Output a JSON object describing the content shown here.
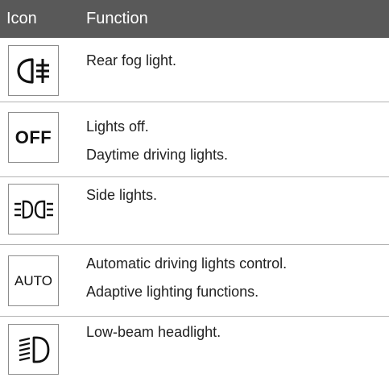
{
  "header": {
    "icon_col": "Icon",
    "function_col": "Function"
  },
  "rows": [
    {
      "icon": "rear-fog-light-icon",
      "lines": [
        "Rear fog light."
      ]
    },
    {
      "icon": "lights-off-icon",
      "icon_text": "OFF",
      "lines": [
        "Lights off.",
        "Daytime driving lights."
      ]
    },
    {
      "icon": "side-lights-icon",
      "lines": [
        "Side lights."
      ]
    },
    {
      "icon": "auto-lights-icon",
      "icon_text": "AUTO",
      "lines": [
        "Automatic driving lights control.",
        "Adaptive lighting functions."
      ]
    },
    {
      "icon": "low-beam-headlight-icon",
      "lines": [
        "Low-beam headlight."
      ]
    }
  ]
}
